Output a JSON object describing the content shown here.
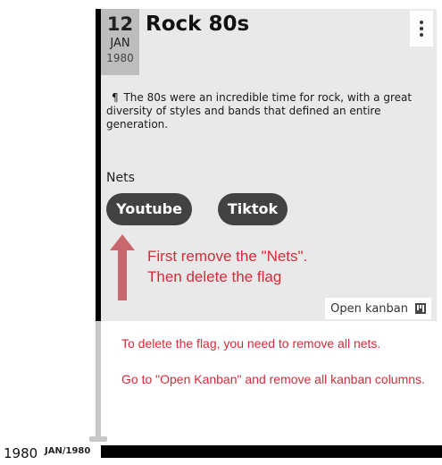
{
  "event": {
    "day": "12",
    "month": "JAN",
    "year": "1980",
    "title": "Rock 80s",
    "pilcrow": "¶",
    "description": "The 80s were an incredible time for rock, with a great diversity of styles and bands that defined an entire generation.",
    "nets_label": "Nets",
    "nets": [
      "Youtube",
      "Tiktok"
    ],
    "open_kanban_label": "Open kanban"
  },
  "annotations": {
    "arrow_hint_line1": "First remove the \"Nets\".",
    "arrow_hint_line2": "Then delete the flag",
    "note_line1": "To delete the flag, you need to remove all nets.",
    "note_line2": "Go to \"Open Kanban\" and remove all kanban columns."
  },
  "timeline": {
    "year": "1980",
    "month_year": "JAN/1980"
  },
  "colors": {
    "card_bg": "#e9e9e9",
    "date_bg": "#bdbdbd",
    "chip_bg": "#424242",
    "annotation_red": "#d62b3a",
    "arrow": "#c9676f"
  },
  "icons": {
    "menu": "vertical-dots-icon",
    "kanban": "kanban-board-icon",
    "arrow": "up-arrow-icon"
  }
}
